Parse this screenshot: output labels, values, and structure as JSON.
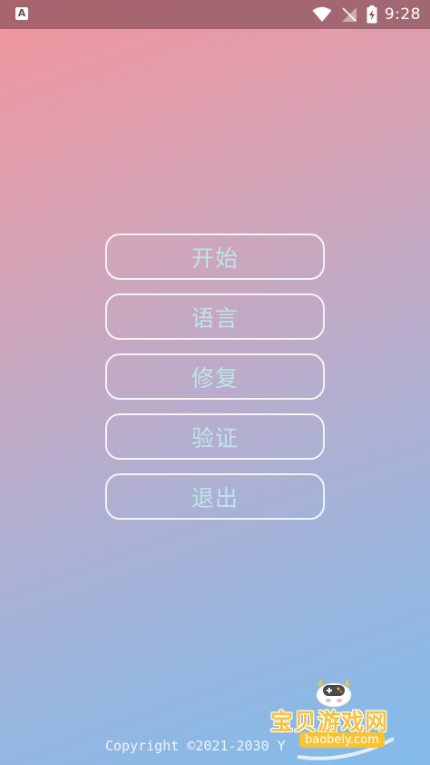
{
  "status_bar": {
    "time": "9:28",
    "app_icon_letter": "A",
    "icons": [
      "app-notification-icon",
      "wifi-icon",
      "no-signal-icon",
      "battery-charging-icon"
    ]
  },
  "menu": {
    "start_label": "开始",
    "language_label": "语言",
    "repair_label": "修复",
    "verify_label": "验证",
    "exit_label": "退出"
  },
  "footer": {
    "copyright": "Copyright ©2021-2030 Y"
  },
  "watermark": {
    "title": "宝贝游戏网",
    "domain": "baobeiy.com"
  },
  "colors": {
    "gradient_top": "#f2959d",
    "gradient_bottom": "#82bbea",
    "button_text": "#bfe3ea",
    "button_border": "#ffffff",
    "watermark_accent": "#f4c23c"
  }
}
